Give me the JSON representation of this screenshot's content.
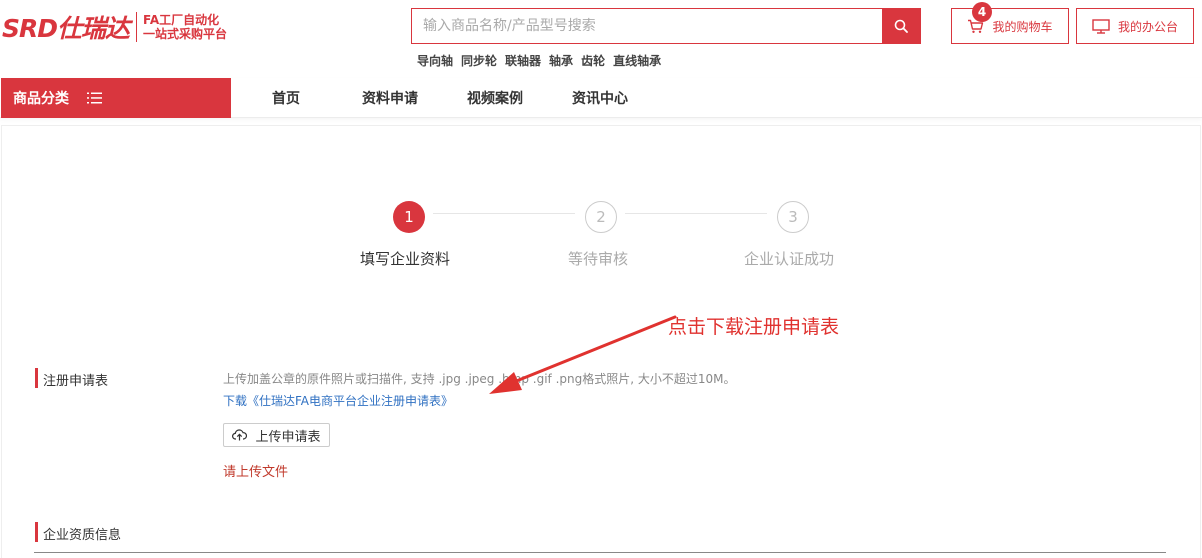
{
  "brand": {
    "logo_text": "SRD仕瑞达",
    "slogan_line1": "FA工厂自动化",
    "slogan_line2": "一站式采购平台",
    "accent_color": "#d9363e"
  },
  "search": {
    "placeholder": "输入商品名称/产品型号搜索",
    "hot_words": [
      "导向轴",
      "同步轮",
      "联轴器",
      "轴承",
      "齿轮",
      "直线轴承"
    ]
  },
  "header_actions": {
    "cart_label": "我的购物车",
    "cart_count": "4",
    "office_label": "我的办公台"
  },
  "nav": {
    "category_label": "商品分类",
    "items": [
      "首页",
      "资料申请",
      "视频案例",
      "资讯中心"
    ]
  },
  "steps": [
    {
      "number": "1",
      "label": "填写企业资料",
      "state": "active"
    },
    {
      "number": "2",
      "label": "等待审核",
      "state": "inactive"
    },
    {
      "number": "3",
      "label": "企业认证成功",
      "state": "inactive"
    }
  ],
  "annotation": {
    "text": "点击下载注册申请表",
    "color": "#e0322f"
  },
  "form": {
    "registration_title": "注册申请表",
    "upload_hint": "上传加盖公章的原件照片或扫描件, 支持 .jpg .jpeg .bmp .gif .png格式照片, 大小不超过10M。",
    "download_link": "下载《仕瑞达FA电商平台企业注册申请表》",
    "upload_button": "上传申请表",
    "error_message": "请上传文件",
    "qualification_title": "企业资质信息"
  },
  "icons": {
    "search": "search-icon",
    "cart": "cart-icon",
    "monitor": "monitor-icon",
    "menu": "menu-icon",
    "upload": "cloud-upload-icon"
  }
}
